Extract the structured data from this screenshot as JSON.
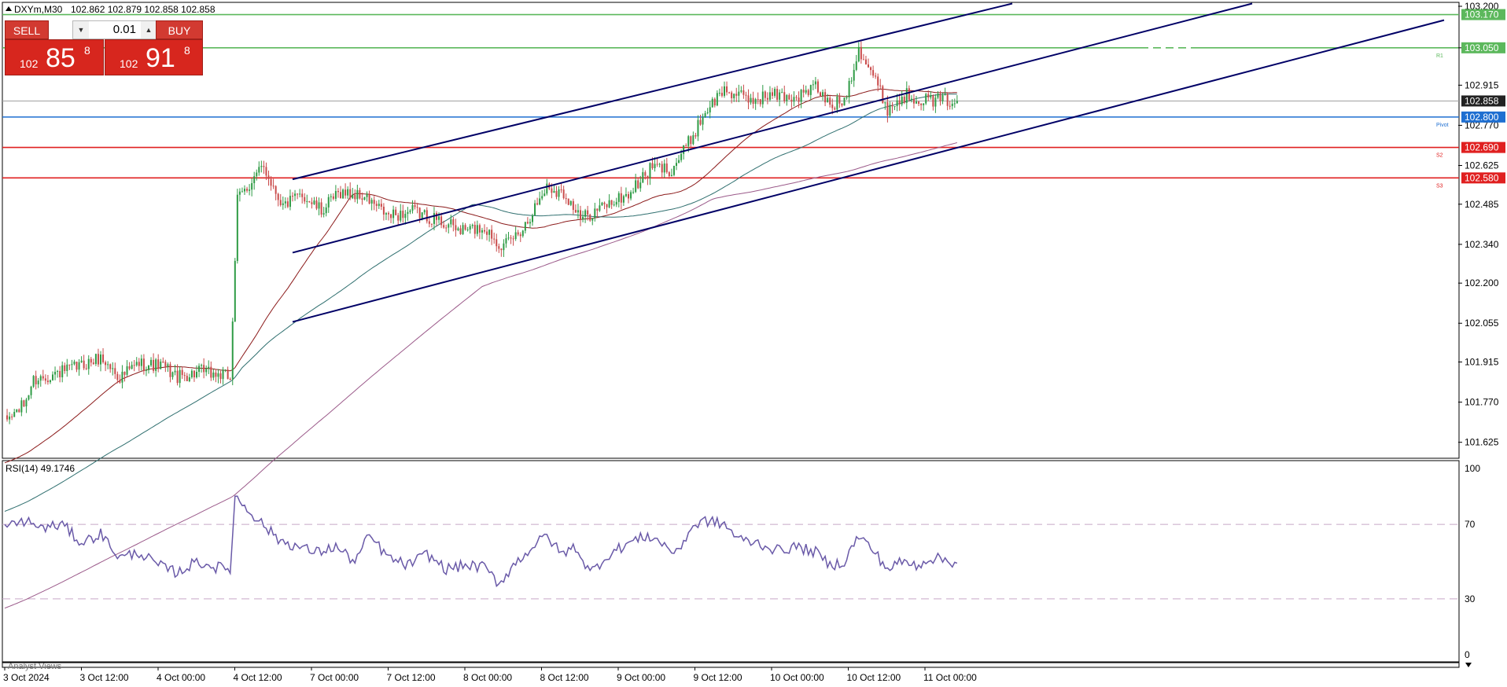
{
  "header": {
    "symbol": "DXYm,M30",
    "ohlc": "102.862 102.879 102.858 102.858",
    "rsi_label": "RSI(14) 49.1746",
    "bottom_label": "Analyst Views"
  },
  "trade_panel": {
    "sell_label": "SELL",
    "buy_label": "BUY",
    "volume": "0.01",
    "sell_small": "102",
    "sell_big": "85",
    "sell_sup": "8",
    "buy_small": "102",
    "buy_big": "91",
    "buy_sup": "8"
  },
  "colors": {
    "bull": "#2e9b45",
    "bear": "#c94a4a",
    "channel": "#000066",
    "resistance": "#5cb85c",
    "pivot": "#1f6fd1",
    "support": "#e02020",
    "rsi": "#6a5aa8",
    "ma_fast": "#8b1a1a",
    "ma_mid": "#2f6f6f",
    "ma_slow": "#9b5a8a"
  },
  "chart_data": [
    {
      "type": "candlestick",
      "title": "",
      "x_labels": [
        "3 Oct 2024",
        "3 Oct 12:00",
        "4 Oct 00:00",
        "4 Oct 12:00",
        "7 Oct 00:00",
        "7 Oct 12:00",
        "8 Oct 00:00",
        "8 Oct 12:00",
        "9 Oct 00:00",
        "9 Oct 12:00",
        "10 Oct 00:00",
        "10 Oct 12:00",
        "11 Oct 00:00"
      ],
      "y_ticks": [
        "103.200",
        "103.050",
        "102.915",
        "102.770",
        "102.625",
        "102.485",
        "102.340",
        "102.200",
        "102.055",
        "101.915",
        "101.770",
        "101.625"
      ],
      "ylim": [
        101.59,
        103.2
      ],
      "anchors": [
        {
          "idx": 0,
          "price": 101.7
        },
        {
          "idx": 8,
          "price": 101.76
        },
        {
          "idx": 12,
          "price": 101.85
        },
        {
          "idx": 20,
          "price": 101.87
        },
        {
          "idx": 28,
          "price": 101.89
        },
        {
          "idx": 40,
          "price": 101.93
        },
        {
          "idx": 48,
          "price": 101.86
        },
        {
          "idx": 56,
          "price": 101.91
        },
        {
          "idx": 66,
          "price": 101.9
        },
        {
          "idx": 72,
          "price": 101.86
        },
        {
          "idx": 82,
          "price": 101.88
        },
        {
          "idx": 94,
          "price": 101.86
        },
        {
          "idx": 97,
          "price": 102.5
        },
        {
          "idx": 104,
          "price": 102.58
        },
        {
          "idx": 108,
          "price": 102.62
        },
        {
          "idx": 116,
          "price": 102.48
        },
        {
          "idx": 124,
          "price": 102.52
        },
        {
          "idx": 132,
          "price": 102.46
        },
        {
          "idx": 140,
          "price": 102.53
        },
        {
          "idx": 150,
          "price": 102.51
        },
        {
          "idx": 160,
          "price": 102.44
        },
        {
          "idx": 170,
          "price": 102.46
        },
        {
          "idx": 180,
          "price": 102.43
        },
        {
          "idx": 190,
          "price": 102.39
        },
        {
          "idx": 200,
          "price": 102.4
        },
        {
          "idx": 208,
          "price": 102.33
        },
        {
          "idx": 216,
          "price": 102.4
        },
        {
          "idx": 226,
          "price": 102.55
        },
        {
          "idx": 234,
          "price": 102.52
        },
        {
          "idx": 240,
          "price": 102.43
        },
        {
          "idx": 250,
          "price": 102.48
        },
        {
          "idx": 260,
          "price": 102.52
        },
        {
          "idx": 270,
          "price": 102.62
        },
        {
          "idx": 278,
          "price": 102.61
        },
        {
          "idx": 286,
          "price": 102.72
        },
        {
          "idx": 292,
          "price": 102.82
        },
        {
          "idx": 300,
          "price": 102.9
        },
        {
          "idx": 310,
          "price": 102.86
        },
        {
          "idx": 320,
          "price": 102.88
        },
        {
          "idx": 330,
          "price": 102.87
        },
        {
          "idx": 338,
          "price": 102.91
        },
        {
          "idx": 344,
          "price": 102.84
        },
        {
          "idx": 350,
          "price": 102.86
        },
        {
          "idx": 356,
          "price": 103.05
        },
        {
          "idx": 362,
          "price": 102.95
        },
        {
          "idx": 368,
          "price": 102.83
        },
        {
          "idx": 376,
          "price": 102.88
        },
        {
          "idx": 385,
          "price": 102.86
        },
        {
          "idx": 394,
          "price": 102.86
        },
        {
          "idx": 397,
          "price": 102.858
        }
      ],
      "h_lines": [
        {
          "price": 103.17,
          "label": "103.170",
          "color": "#5cb85c",
          "tag": ""
        },
        {
          "price": 103.05,
          "label": "103.050",
          "color": "#5cb85c",
          "tag": "R1"
        },
        {
          "price": 102.858,
          "label": "102.858",
          "color": "#a0a0a0",
          "tag": ""
        },
        {
          "price": 102.8,
          "label": "102.800",
          "color": "#1f6fd1",
          "tag": "Pivot"
        },
        {
          "price": 102.69,
          "label": "102.690",
          "color": "#e02020",
          "tag": "S2"
        },
        {
          "price": 102.58,
          "label": "102.580",
          "color": "#e02020",
          "tag": "S3"
        }
      ],
      "channels": [
        {
          "from": [
            120,
            102.575
          ],
          "to": [
            420,
            103.21
          ]
        },
        {
          "from": [
            120,
            102.31
          ],
          "to": [
            520,
            103.21
          ]
        },
        {
          "from": [
            120,
            102.06
          ],
          "to": [
            600,
            103.15
          ]
        }
      ]
    },
    {
      "type": "line",
      "title": "",
      "series_label": "RSI(14) 49.1746",
      "y_ticks": [
        "100",
        "70",
        "30",
        "0"
      ],
      "ylim": [
        0,
        100
      ],
      "levels": [
        70,
        30
      ],
      "anchors": [
        {
          "idx": 0,
          "value": 68
        },
        {
          "idx": 8,
          "value": 72
        },
        {
          "idx": 16,
          "value": 68
        },
        {
          "idx": 24,
          "value": 70
        },
        {
          "idx": 32,
          "value": 60
        },
        {
          "idx": 40,
          "value": 65
        },
        {
          "idx": 48,
          "value": 52
        },
        {
          "idx": 56,
          "value": 55
        },
        {
          "idx": 64,
          "value": 48
        },
        {
          "idx": 72,
          "value": 44
        },
        {
          "idx": 80,
          "value": 50
        },
        {
          "idx": 88,
          "value": 47
        },
        {
          "idx": 94,
          "value": 46
        },
        {
          "idx": 96,
          "value": 85
        },
        {
          "idx": 100,
          "value": 80
        },
        {
          "idx": 106,
          "value": 72
        },
        {
          "idx": 114,
          "value": 62
        },
        {
          "idx": 122,
          "value": 58
        },
        {
          "idx": 130,
          "value": 55
        },
        {
          "idx": 138,
          "value": 58
        },
        {
          "idx": 146,
          "value": 50
        },
        {
          "idx": 152,
          "value": 64
        },
        {
          "idx": 160,
          "value": 52
        },
        {
          "idx": 168,
          "value": 48
        },
        {
          "idx": 176,
          "value": 54
        },
        {
          "idx": 184,
          "value": 46
        },
        {
          "idx": 192,
          "value": 48
        },
        {
          "idx": 200,
          "value": 47
        },
        {
          "idx": 206,
          "value": 38
        },
        {
          "idx": 212,
          "value": 48
        },
        {
          "idx": 220,
          "value": 58
        },
        {
          "idx": 226,
          "value": 64
        },
        {
          "idx": 232,
          "value": 54
        },
        {
          "idx": 238,
          "value": 58
        },
        {
          "idx": 244,
          "value": 44
        },
        {
          "idx": 252,
          "value": 54
        },
        {
          "idx": 260,
          "value": 60
        },
        {
          "idx": 268,
          "value": 64
        },
        {
          "idx": 274,
          "value": 60
        },
        {
          "idx": 280,
          "value": 54
        },
        {
          "idx": 286,
          "value": 68
        },
        {
          "idx": 292,
          "value": 72
        },
        {
          "idx": 300,
          "value": 70
        },
        {
          "idx": 306,
          "value": 62
        },
        {
          "idx": 314,
          "value": 60
        },
        {
          "idx": 322,
          "value": 56
        },
        {
          "idx": 330,
          "value": 58
        },
        {
          "idx": 338,
          "value": 55
        },
        {
          "idx": 344,
          "value": 48
        },
        {
          "idx": 350,
          "value": 50
        },
        {
          "idx": 356,
          "value": 64
        },
        {
          "idx": 362,
          "value": 56
        },
        {
          "idx": 368,
          "value": 46
        },
        {
          "idx": 374,
          "value": 50
        },
        {
          "idx": 380,
          "value": 48
        },
        {
          "idx": 386,
          "value": 52
        },
        {
          "idx": 392,
          "value": 51
        },
        {
          "idx": 397,
          "value": 49.17
        }
      ]
    }
  ]
}
